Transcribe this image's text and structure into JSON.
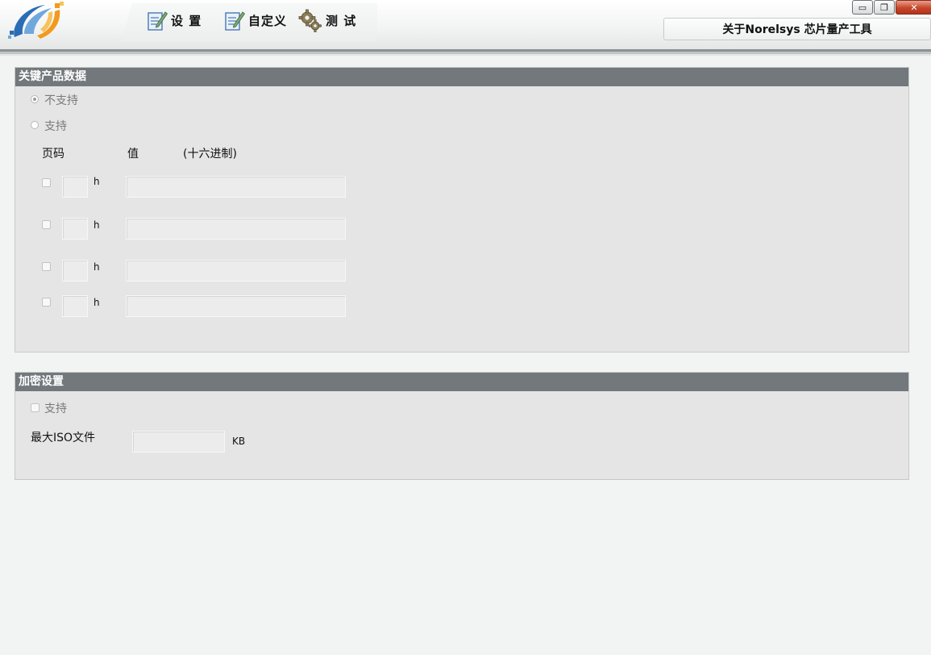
{
  "toolbar": {
    "tabs": [
      {
        "label": "设 置",
        "icon": "pencil-note-icon"
      },
      {
        "label": "自定义",
        "icon": "pencil-note-icon"
      },
      {
        "label": "测 试",
        "icon": "gears-icon"
      }
    ],
    "about_label": "关于Norelsys 芯片量产工具"
  },
  "window_controls": {
    "minimize": "▭",
    "restore": "❐",
    "close": "✕"
  },
  "vpd_panel": {
    "title": "关键产品数据",
    "option_unsupported": "不支持",
    "option_supported": "支持",
    "col_page": "页码",
    "col_value": "值",
    "col_hex": "(十六进制)",
    "rows": [
      {
        "suffix": "h",
        "page": "",
        "value": ""
      },
      {
        "suffix": "h",
        "page": "",
        "value": ""
      },
      {
        "suffix": "h",
        "page": "",
        "value": ""
      },
      {
        "suffix": "h",
        "page": "",
        "value": ""
      }
    ]
  },
  "encrypt_panel": {
    "title": "加密设置",
    "support_label": "支持",
    "max_iso_label": "最大ISO文件",
    "max_iso_value": "",
    "unit": "KB"
  },
  "colors": {
    "panel_header": "#72787b",
    "panel_body": "#e5e5e5",
    "background": "#f2f3f3"
  }
}
